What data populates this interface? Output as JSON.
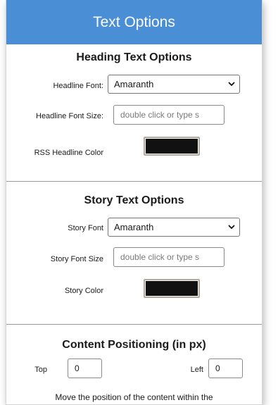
{
  "window": {
    "title": "Text Options"
  },
  "heading_section": {
    "title": "Heading Text Options",
    "font_label": "Headline Font:",
    "font_value": "Amaranth",
    "size_label": "Headline Font Size:",
    "size_placeholder": "double click or type s",
    "color_label": "RSS Headline Color",
    "color_value": "#111111"
  },
  "story_section": {
    "title": "Story Text Options",
    "font_label": "Story Font",
    "font_value": "Amaranth",
    "size_label": "Story Font Size",
    "size_placeholder": "double click or type s",
    "color_label": "Story Color",
    "color_value": "#111111"
  },
  "positioning_section": {
    "title": "Content Positioning (in px)",
    "top_label": "Top",
    "top_value": "0",
    "left_label": "Left",
    "left_value": "0",
    "description": "Move the position of the content within the"
  },
  "colors": {
    "title_bar": "#4a8fd6",
    "title_text": "#ffffff"
  }
}
